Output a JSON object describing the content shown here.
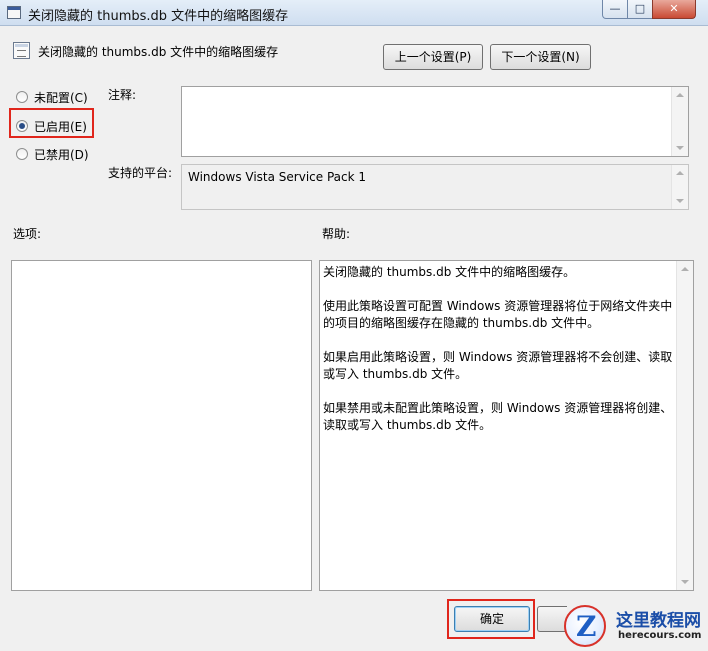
{
  "window": {
    "title": "关闭隐藏的 thumbs.db 文件中的缩略图缓存",
    "buttons": {
      "minimize": "—",
      "maximize": "□",
      "close": "✕"
    }
  },
  "header": {
    "setting_name": "关闭隐藏的 thumbs.db 文件中的缩略图缓存",
    "prev_button": "上一个设置(P)",
    "next_button": "下一个设置(N)"
  },
  "state": {
    "options": [
      {
        "label": "未配置(C)",
        "selected": false
      },
      {
        "label": "已启用(E)",
        "selected": true
      },
      {
        "label": "已禁用(D)",
        "selected": false
      }
    ]
  },
  "comment": {
    "label": "注释:",
    "value": ""
  },
  "platform": {
    "label": "支持的平台:",
    "value": "Windows Vista Service Pack 1"
  },
  "options_section": {
    "label": "选项:"
  },
  "help_section": {
    "label": "帮助:",
    "paragraphs": [
      "关闭隐藏的 thumbs.db 文件中的缩略图缓存。",
      "使用此策略设置可配置 Windows 资源管理器将位于网络文件夹中的项目的缩略图缓存在隐藏的 thumbs.db 文件中。",
      "如果启用此策略设置，则 Windows 资源管理器将不会创建、读取或写入 thumbs.db 文件。",
      "如果禁用或未配置此策略设置，则 Windows 资源管理器将创建、读取或写入 thumbs.db 文件。"
    ]
  },
  "footer": {
    "ok_button": "确定"
  },
  "watermark": {
    "logo_letter": "Z",
    "site_name": "这里教程网",
    "site_url": "herecours.com"
  },
  "colors": {
    "highlight": "#e0261c",
    "selected_radio": "#2a4d87"
  }
}
